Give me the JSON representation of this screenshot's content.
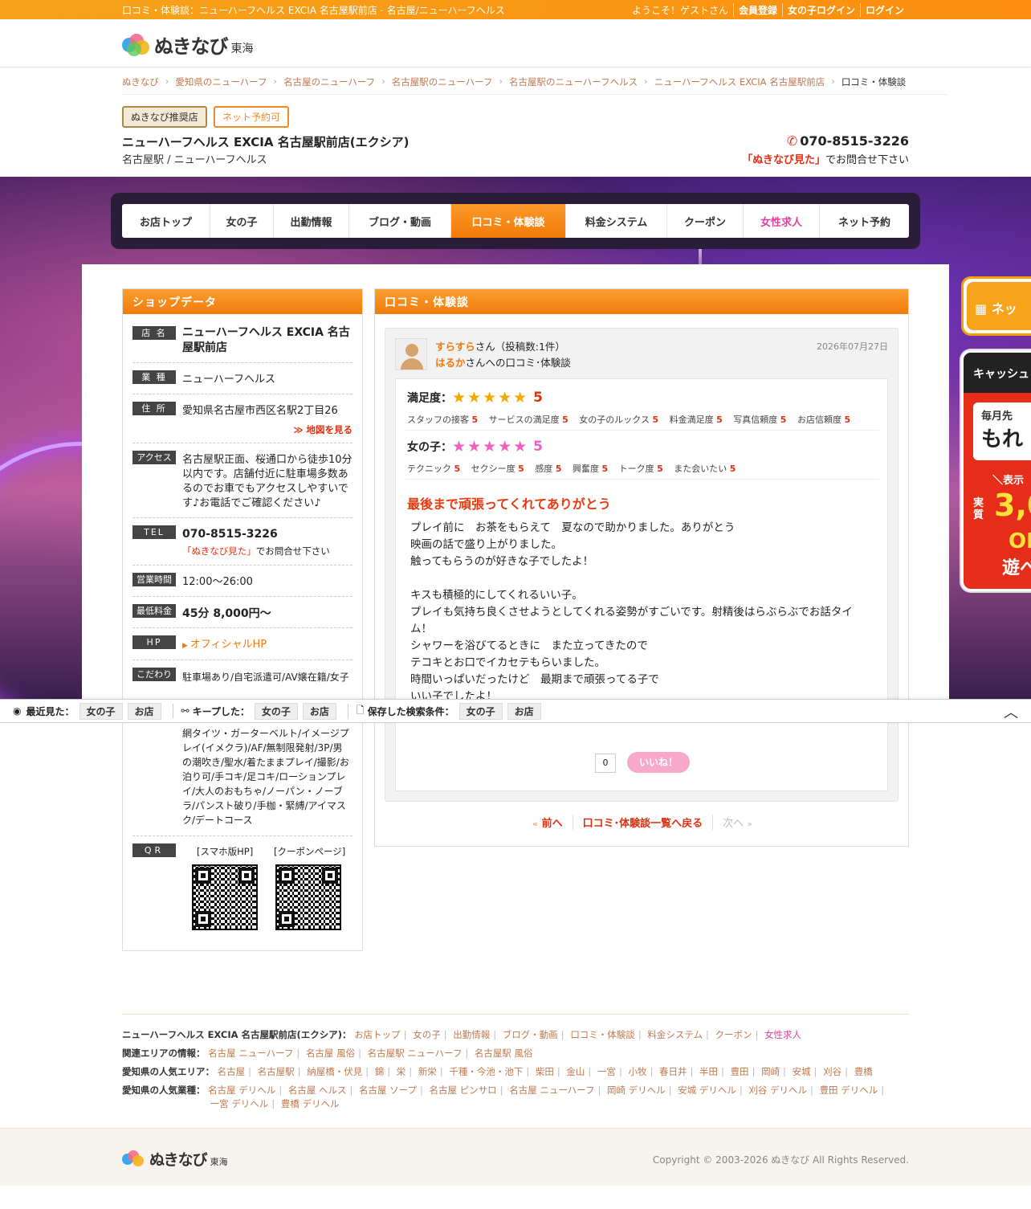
{
  "topbar": {
    "page_title": "口コミ・体験談：ニューハーフヘルス EXCIA 名古屋駅前店 - 名古屋/ニューハーフヘルス",
    "welcome": "ようこそ！ゲストさん",
    "register": "会員登録",
    "girl_login": "女の子ログイン",
    "login": "ログイン"
  },
  "logo": {
    "text": "ぬきなび",
    "region": "東海"
  },
  "breadcrumb": [
    "ぬきなび",
    "愛知県のニューハーフ",
    "名古屋のニューハーフ",
    "名古屋駅のニューハーフ",
    "名古屋駅のニューハーフヘルス",
    "ニューハーフヘルス EXCIA 名古屋駅前店",
    "口コミ・体験談"
  ],
  "shop": {
    "badge_recommend": "ぬきなび推奨店",
    "badge_net": "ネット予約可",
    "name": "ニューハーフヘルス EXCIA 名古屋駅前店(エクシア)",
    "sub": "名古屋駅 / ニューハーフヘルス",
    "phone": "070-8515-3226",
    "phone_note_red": "「ぬきなび見た」",
    "phone_note": "でお問合せ下さい"
  },
  "nav": [
    {
      "label": "お店トップ"
    },
    {
      "label": "女の子"
    },
    {
      "label": "出勤情報"
    },
    {
      "label": "ブログ・動画"
    },
    {
      "label": "口コミ・体験談"
    },
    {
      "label": "料金システム"
    },
    {
      "label": "クーポン"
    },
    {
      "label": "女性求人"
    },
    {
      "label": "ネット予約"
    }
  ],
  "shopdata": {
    "heading": "ショップデータ",
    "name_label": "店 名",
    "name": "ニューハーフヘルス EXCIA 名古屋駅前店",
    "type_label": "業 種",
    "type": "ニューハーフヘルス",
    "addr_label": "住 所",
    "addr": "愛知県名古屋市西区名駅2丁目26",
    "map_link": "≫ 地図を見る",
    "access_label": "アクセス",
    "access": "名古屋駅正面、桜通口から徒歩10分以内です。店舗付近に駐車場多数あるのでお車でもアクセスしやすいです♪お電話でご確認ください♪",
    "tel_label": "TEL",
    "tel": "070-8515-3226",
    "tel_note_red": "「ぬきなび見た」",
    "tel_note": "でお問合せ下さい",
    "hours_label": "営業時間",
    "hours": "12:00〜26:00",
    "price_label": "最低料金",
    "price": "45分 8,000円〜",
    "hp_label": "HP",
    "hp": "オフィシャルHP",
    "kodawari_label": "こだわり",
    "kodawari_top": "駐車場あり/自宅派遣可/AV嬢在籍/女子",
    "kodawari_rest": "網タイツ・ガーターベルト/イメージプレイ(イメクラ)/AF/無制限発射/3P/男の潮吹き/聖水/着たままプレイ/撮影/お泊り可/手コキ/足コキ/ローションプレイ/大人のおもちゃ/ノーパン・ノーブラ/パンスト破り/手枷・緊縛/アイマスク/デートコース",
    "qr_label": "QR",
    "qr_sp": "[スマホ版HP]",
    "qr_coupon": "[クーポンページ]"
  },
  "review": {
    "heading": "口コミ・体験談",
    "reviewer": "すらすら",
    "reviewer_suffix": "さん（投稿数:1件）",
    "girl": "はるか",
    "girl_suffix": "さんへの口コミ･体験談",
    "date": "2026年07月27日",
    "satisfaction_label": "満足度：",
    "satisfaction": "5",
    "satisfaction_items": [
      {
        "label": "スタッフの接客",
        "value": "5"
      },
      {
        "label": "サービスの満足度",
        "value": "5"
      },
      {
        "label": "女の子のルックス",
        "value": "5"
      },
      {
        "label": "料金満足度",
        "value": "5"
      },
      {
        "label": "写真信頼度",
        "value": "5"
      },
      {
        "label": "お店信頼度",
        "value": "5"
      }
    ],
    "girl_label": "女の子：",
    "girl_score": "5",
    "girl_items": [
      {
        "label": "テクニック",
        "value": "5"
      },
      {
        "label": "セクシー度",
        "value": "5"
      },
      {
        "label": "感度",
        "value": "5"
      },
      {
        "label": "興奮度",
        "value": "5"
      },
      {
        "label": "トーク度",
        "value": "5"
      },
      {
        "label": "また会いたい",
        "value": "5"
      }
    ],
    "title": "最後まで頑張ってくれてありがとう",
    "body": [
      "プレイ前に　お茶をもらえて　夏なので助かりました。ありがとう",
      "映画の話で盛り上がりました。",
      "触ってもらうのが好きな子でしたよ！",
      "",
      "キスも積極的にしてくれるいい子。",
      "プレイも気持ち良くさせようとしてくれる姿勢がすごいです。射精後はらぶらぶでお話タイム！",
      "シャワーを浴びてるときに　また立ってきたので",
      "テコキとお口でイカセテもらいました。",
      "時間いっぱいだったけど　最期まで頑張ってる子で",
      "いい子でしたよ！"
    ],
    "like_count": "0",
    "like_label": "いいね！",
    "prev": "前へ",
    "back": "口コミ･体験談一覧へ戻る",
    "next": "次へ"
  },
  "bottombar": {
    "recent_label": "最近見た：",
    "recent_girl": "女の子",
    "recent_shop": "お店",
    "keep_label": "キープした：",
    "keep_girl": "女の子",
    "keep_shop": "お店",
    "saved_label": "保存した検索条件：",
    "saved_girl": "女の子",
    "saved_shop": "お店"
  },
  "side": {
    "banner1": "ネッ",
    "banner2_head": "キャッシュ",
    "banner2_a": "毎月先",
    "banner2_b": "もれ",
    "banner2_c": "＼表示",
    "banner2_d": "実質",
    "banner2_e": "3,0",
    "banner2_f": "OI",
    "banner2_g": "遊べ"
  },
  "footer": {
    "shop_label": "ニューハーフヘルス EXCIA 名古屋駅前店(エクシア)：",
    "shop_links": [
      "お店トップ",
      "女の子",
      "出勤情報",
      "ブログ・動画",
      "口コミ・体験談",
      "料金システム",
      "クーポン",
      "女性求人"
    ],
    "area_label": "関連エリアの情報：",
    "area_links": [
      "名古屋 ニューハーフ",
      "名古屋 風俗",
      "名古屋駅 ニューハーフ",
      "名古屋駅 風俗"
    ],
    "pop_area_label": "愛知県の人気エリア：",
    "pop_area_links": [
      "名古屋",
      "名古屋駅",
      "納屋橋・伏見",
      "錦",
      "栄",
      "新栄",
      "千種・今池・池下",
      "柴田",
      "金山",
      "一宮",
      "小牧",
      "春日井",
      "半田",
      "豊田",
      "岡崎",
      "安城",
      "刈谷",
      "豊橋"
    ],
    "pop_type_label": "愛知県の人気業種：",
    "pop_type_links": [
      "名古屋 デリヘル",
      "名古屋 ヘルス",
      "名古屋 ソープ",
      "名古屋 ピンサロ",
      "名古屋 ニューハーフ",
      "岡崎 デリヘル",
      "安城 デリヘル",
      "刈谷 デリヘル",
      "豊田 デリヘル",
      "一宮 デリヘル",
      "豊橋 デリヘル"
    ],
    "copyright": "Copyright © 2003-2026 ぬきなび All Rights Reserved."
  }
}
